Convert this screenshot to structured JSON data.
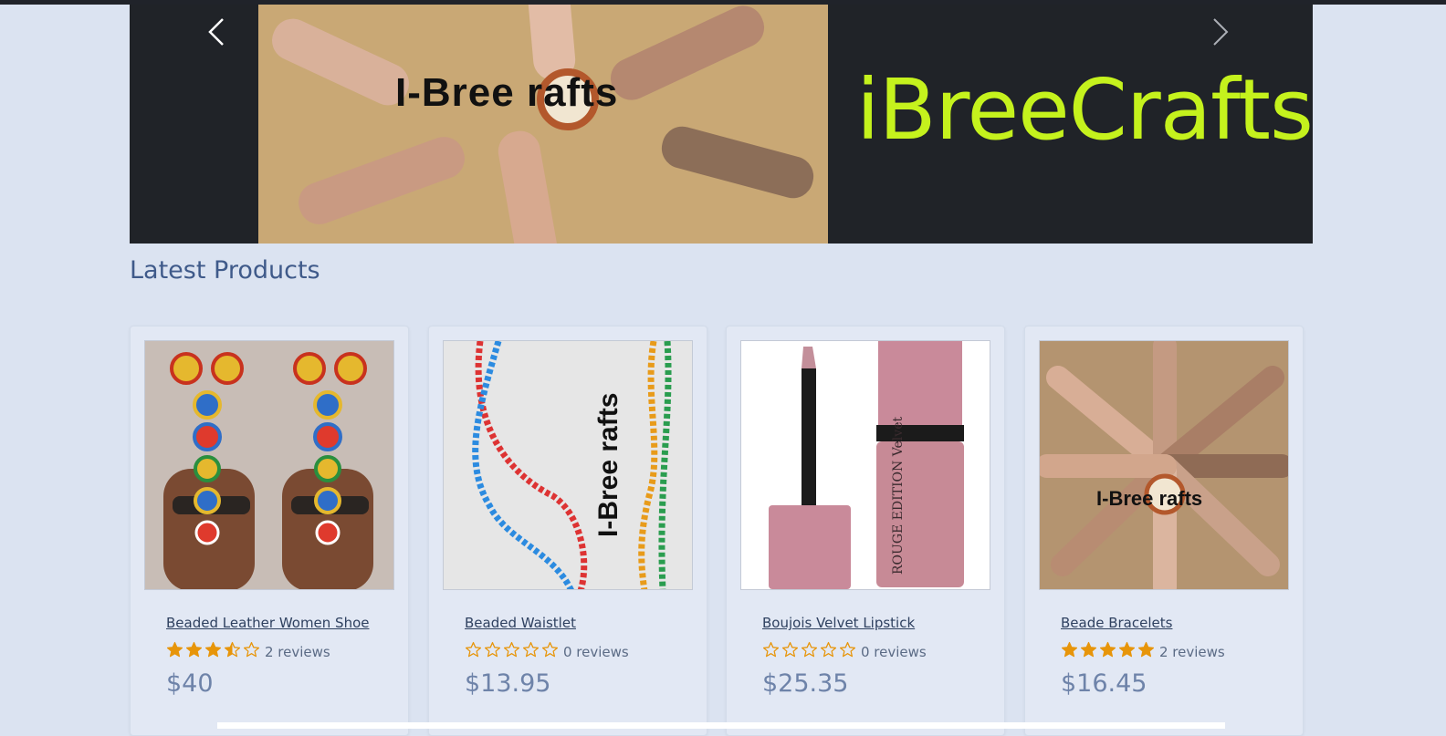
{
  "hero": {
    "logo_text": "I-Bree rafts",
    "brand_title": "iBreeCrafts",
    "prev_icon": "chevron-left-icon",
    "next_icon": "chevron-right-icon"
  },
  "section": {
    "title": "Latest Products"
  },
  "products": [
    {
      "name": "Beaded Leather Women Shoe",
      "rating": 3.5,
      "reviews": "2 reviews",
      "price": "$40",
      "image": "beaded-sandals"
    },
    {
      "name": "Beaded Waistlet",
      "rating": 0,
      "reviews": "0 reviews",
      "price": "$13.95",
      "image": "beaded-waistlet",
      "image_text": "I-Bree rafts"
    },
    {
      "name": "Boujois Velvet Lipstick",
      "rating": 0,
      "reviews": "0 reviews",
      "price": "$25.35",
      "image": "velvet-lipstick",
      "image_text": "ROUGE EDITION Velvet"
    },
    {
      "name": "Beade Bracelets",
      "rating": 5,
      "reviews": "2 reviews",
      "price": "$16.45",
      "image": "beaded-bracelets",
      "image_text": "I-Bree rafts"
    }
  ],
  "colors": {
    "page_bg": "#dbe3f1",
    "star": "#e7950a",
    "brand": "#c5f21d",
    "price": "#6e83a9"
  }
}
